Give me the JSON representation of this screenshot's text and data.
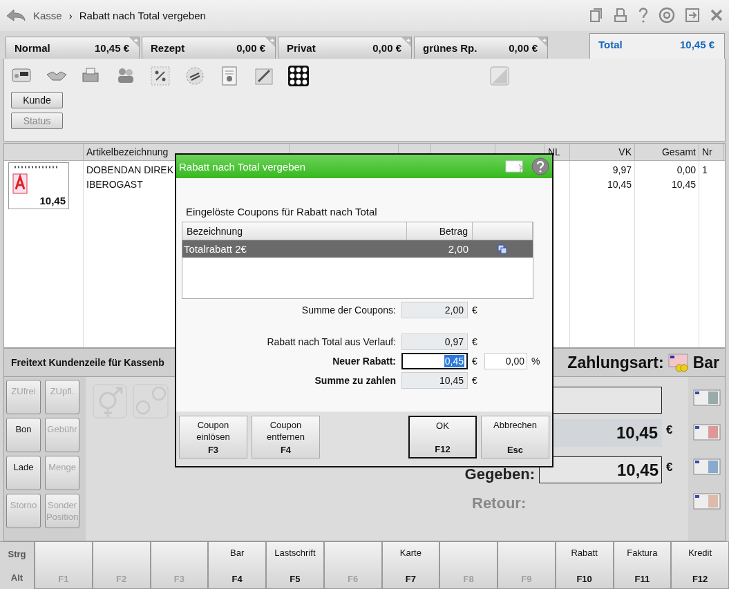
{
  "breadcrumb": {
    "root": "Kasse",
    "separator": "›",
    "title": "Rabatt nach Total vergeben"
  },
  "tabs": [
    {
      "label": "Normal",
      "amount": "10,45 €",
      "selected": false
    },
    {
      "label": "Rezept",
      "amount": "0,00 €",
      "selected": false
    },
    {
      "label": "Privat",
      "amount": "0,00 €",
      "selected": false
    },
    {
      "label": "grünes Rp.",
      "amount": "0,00 €",
      "selected": false
    },
    {
      "label": "Total",
      "amount": "10,45 €",
      "selected": true
    }
  ],
  "toolbar": {
    "buttons": [
      {
        "label": "Kunde",
        "disabled": false
      },
      {
        "label": "Status",
        "disabled": true
      }
    ]
  },
  "table": {
    "columns": [
      "Artikelbezeichnung",
      "NL",
      "VK",
      "Gesamt",
      "Nr"
    ],
    "thumbnail_price": "10,45",
    "rows": [
      {
        "name": "DOBENDAN DIREK",
        "vk": "9,97",
        "total": "0,00",
        "nr": "1"
      },
      {
        "name": "IBEROGAST",
        "vk": "10,45",
        "total": "10,45"
      }
    ]
  },
  "footer_text": "Freitext Kundenzeile für Kassenb",
  "payment": {
    "label": "Zahlungsart:",
    "method": "Bar"
  },
  "keypad": [
    {
      "label": "ZUfrei",
      "disabled": true
    },
    {
      "label": "ZUpfl.",
      "disabled": true
    },
    {
      "label": "Bon",
      "disabled": false
    },
    {
      "label": "Gebühr",
      "disabled": true
    },
    {
      "label": "Lade",
      "disabled": false
    },
    {
      "label": "Menge",
      "disabled": true
    },
    {
      "label": "Storno",
      "disabled": true
    },
    {
      "label": "Sonder Position",
      "disabled": true
    }
  ],
  "amounts": {
    "total": "10,45",
    "currency": "€",
    "given_label": "Gegeben:",
    "given": "10,45",
    "given_currency": "€",
    "return_label": "Retour:"
  },
  "fkeys": {
    "modifiers": [
      "Strg",
      "Alt"
    ],
    "keys": [
      {
        "key": "F1",
        "disabled": true
      },
      {
        "key": "F2",
        "disabled": true
      },
      {
        "key": "F3",
        "disabled": true
      },
      {
        "label": "Bar",
        "key": "F4",
        "disabled": false
      },
      {
        "label": "Lastschrift",
        "key": "F5",
        "disabled": false
      },
      {
        "key": "F6",
        "disabled": true
      },
      {
        "label": "Karte",
        "key": "F7",
        "disabled": false
      },
      {
        "key": "F8",
        "disabled": true
      },
      {
        "key": "F9",
        "disabled": true
      },
      {
        "label": "Rabatt",
        "key": "F10",
        "disabled": false
      },
      {
        "label": "Faktura",
        "key": "F11",
        "disabled": false
      },
      {
        "label": "Kredit",
        "key": "F12",
        "disabled": false
      }
    ]
  },
  "dialog": {
    "title": "Rabatt nach Total vergeben",
    "section_label": "Eingelöste Coupons für Rabatt nach Total",
    "columns": [
      "Bezeichnung",
      "Betrag"
    ],
    "rows": [
      {
        "name": "Totalrabatt 2€",
        "amount": "2,00",
        "selected": true
      }
    ],
    "fields": [
      {
        "label": "Summe der Coupons:",
        "value": "2,00",
        "unit": "€",
        "kind": "readonly",
        "bold": false
      },
      {
        "label": "Rabatt nach Total aus Verlauf:",
        "value": "0,97",
        "unit": "€",
        "kind": "readonly",
        "bold": false
      },
      {
        "label": "Neuer Rabatt:",
        "value": "0,45",
        "unit": "€",
        "kind": "input",
        "bold": true,
        "percent": "0,00",
        "percent_unit": "%"
      },
      {
        "label": "Summe zu zahlen",
        "value": "10,45",
        "unit": "€",
        "kind": "readonly",
        "bold": true
      }
    ],
    "buttons": [
      {
        "lines": [
          "Coupon",
          "einlösen"
        ],
        "key": "F3",
        "default": false
      },
      {
        "lines": [
          "Coupon",
          "entfernen"
        ],
        "key": "F4",
        "default": false
      },
      {
        "lines": [
          "OK"
        ],
        "key": "F12",
        "default": true
      },
      {
        "lines": [
          "Abbrechen"
        ],
        "key": "Esc",
        "default": false
      }
    ]
  }
}
